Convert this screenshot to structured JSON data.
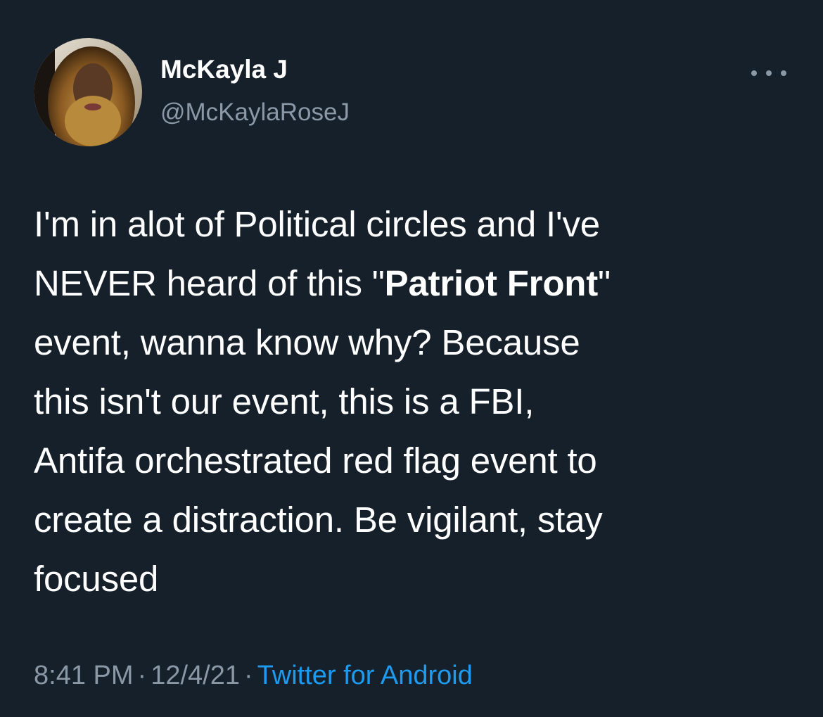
{
  "tweet": {
    "author": {
      "display_name": "McKayla J",
      "handle": "@McKaylaRoseJ",
      "avatar_icon": "profile-photo"
    },
    "more_icon": "more-horizontal-icon",
    "body": {
      "line1": "I'm in alot of Political circles and I've",
      "line2_before": "NEVER heard of this \"",
      "line2_bold": "Patriot Front",
      "line2_after": "\"",
      "line3": "event, wanna know why? Because",
      "line4": "this isn't our event, this is a FBI,",
      "line5": "Antifa orchestrated red flag event to",
      "line6": "create a distraction. Be vigilant, stay",
      "line7": "focused"
    },
    "meta": {
      "time": "8:41 PM",
      "separator": "·",
      "date": "12/4/21",
      "source": "Twitter for Android"
    }
  },
  "colors": {
    "background": "#15202b",
    "primary_text": "#ffffff",
    "secondary_text": "#8b98a5",
    "link": "#1d9bf0"
  }
}
